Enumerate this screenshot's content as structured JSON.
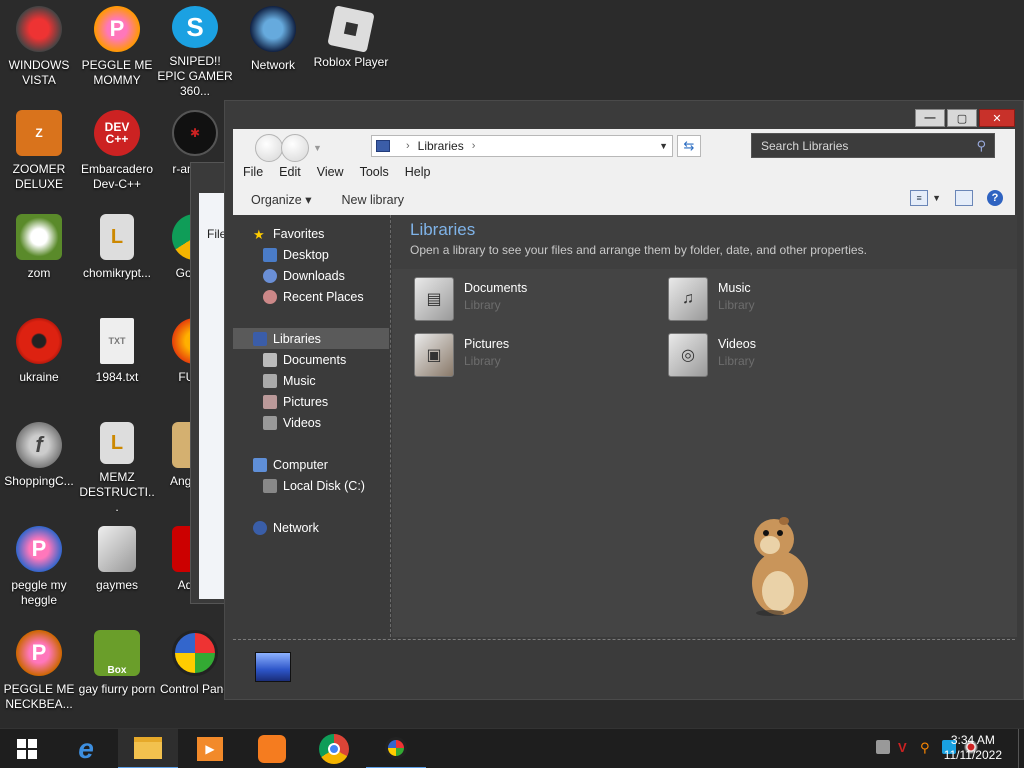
{
  "desktop": {
    "icons": [
      {
        "label": "WINDOWS VISTA"
      },
      {
        "label": "PEGGLE ME MOMMY"
      },
      {
        "label": "SNIPED!! EPIC GAMER 360..."
      },
      {
        "label": "Network"
      },
      {
        "label": "Roblox Player"
      },
      {
        "label": "ZOOMER DELUXE"
      },
      {
        "label": "Embarcadero Dev-C++"
      },
      {
        "label": "r-am par"
      },
      {
        "label": "zom"
      },
      {
        "label": "chomikrypt..."
      },
      {
        "label": "Go Chr"
      },
      {
        "label": "ukraine"
      },
      {
        "label": "1984.txt"
      },
      {
        "label": "FURR"
      },
      {
        "label": "ShoppingC..."
      },
      {
        "label": "MEMZ DESTRUCTI..."
      },
      {
        "label": "Angr Sea"
      },
      {
        "label": "peggle my heggle"
      },
      {
        "label": "gaymes"
      },
      {
        "label": "Adobe"
      },
      {
        "label": "PEGGLE ME NECKBEA..."
      },
      {
        "label": "gay fiurry porn"
      },
      {
        "label": "Control Pane"
      }
    ],
    "ghost_label": "File"
  },
  "explorer": {
    "address": {
      "crumb": "Libraries"
    },
    "search": {
      "placeholder": "Search Libraries"
    },
    "menu": [
      "File",
      "Edit",
      "View",
      "Tools",
      "Help"
    ],
    "commands": {
      "organize": "Organize ▾",
      "new_library": "New library"
    },
    "nav": {
      "favorites": "Favorites",
      "desktop": "Desktop",
      "downloads": "Downloads",
      "recent": "Recent Places",
      "libraries": "Libraries",
      "documents": "Documents",
      "music": "Music",
      "pictures": "Pictures",
      "videos": "Videos",
      "computer": "Computer",
      "local_disk": "Local Disk (C:)",
      "network": "Network"
    },
    "content": {
      "title": "Libraries",
      "subtitle": "Open a library to see your files and arrange them by folder, date, and other properties.",
      "libraries": [
        {
          "name": "Documents",
          "type": "Library"
        },
        {
          "name": "Music",
          "type": "Library"
        },
        {
          "name": "Pictures",
          "type": "Library"
        },
        {
          "name": "Videos",
          "type": "Library"
        }
      ]
    }
  },
  "taskbar": {
    "time": "3:34 AM",
    "date": "11/11/2022"
  }
}
